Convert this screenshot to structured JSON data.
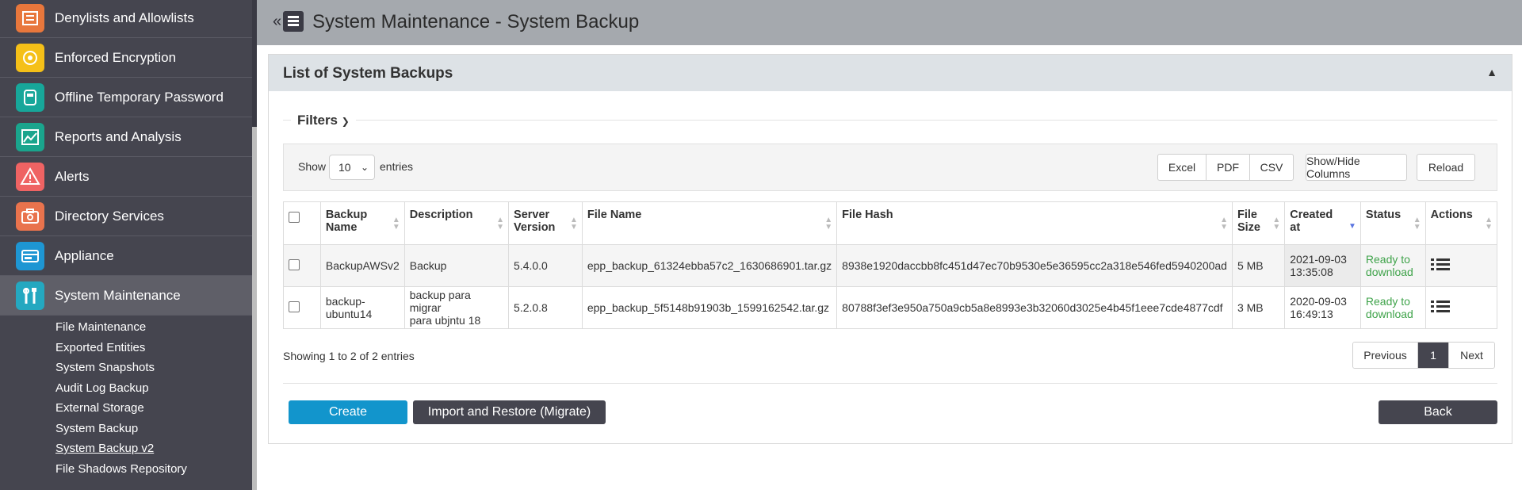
{
  "sidebar": {
    "items": [
      {
        "label": "Denylists and Allowlists",
        "icon": "list-icon",
        "color": "#e8773c"
      },
      {
        "label": "Enforced Encryption",
        "icon": "encryption-icon",
        "color": "#f5c018"
      },
      {
        "label": "Offline Temporary Password",
        "icon": "password-icon",
        "color": "#17a79a"
      },
      {
        "label": "Reports and Analysis",
        "icon": "chart-icon",
        "color": "#1aa58d"
      },
      {
        "label": "Alerts",
        "icon": "alert-icon",
        "color": "#ef6363"
      },
      {
        "label": "Directory Services",
        "icon": "directory-icon",
        "color": "#e9734d"
      },
      {
        "label": "Appliance",
        "icon": "appliance-icon",
        "color": "#1e96d3"
      },
      {
        "label": "System Maintenance",
        "icon": "tools-icon",
        "color": "#24a8c0"
      }
    ],
    "sub_items": [
      "File Maintenance",
      "Exported Entities",
      "System Snapshots",
      "Audit Log Backup",
      "External Storage",
      "System Backup",
      "System Backup v2",
      "File Shadows Repository"
    ]
  },
  "header": {
    "title": "System Maintenance - System Backup"
  },
  "panel": {
    "title": "List of System Backups",
    "filters_label": "Filters"
  },
  "toolbar": {
    "show_label": "Show",
    "page_length": "10",
    "entries_label": "entries",
    "excel": "Excel",
    "pdf": "PDF",
    "csv": "CSV",
    "columns": "Show/Hide Columns",
    "reload": "Reload"
  },
  "table": {
    "headers": {
      "name_1": "Backup",
      "name_2": "Name",
      "description": "Description",
      "version_1": "Server",
      "version_2": "Version",
      "file_name": "File Name",
      "file_hash": "File Hash",
      "size_1": "File",
      "size_2": "Size",
      "created_1": "Created",
      "created_2": "at",
      "status": "Status",
      "actions": "Actions"
    },
    "rows": [
      {
        "name_1": "BackupAWSv2",
        "name_2": "",
        "description_1": "Backup",
        "description_2": "",
        "version": "5.4.0.0",
        "file_name": "epp_backup_61324ebba57c2_1630686901.tar.gz",
        "file_hash": "8938e1920daccbb8fc451d47ec70b9530e5e36595cc2a318e546fed5940200ad",
        "size": "5 MB",
        "created_1": "2021-09-03",
        "created_2": "13:35:08",
        "status_1": "Ready to",
        "status_2": "download"
      },
      {
        "name_1": "backup-",
        "name_2": "ubuntu14",
        "description_1": "backup para migrar",
        "description_2": "para ubjntu 18",
        "version": "5.2.0.8",
        "file_name": "epp_backup_5f5148b91903b_1599162542.tar.gz",
        "file_hash": "80788f3ef3e950a750a9cb5a8e8993e3b32060d3025e4b45f1eee7cde4877cdf",
        "size": "3 MB",
        "created_1": "2020-09-03",
        "created_2": "16:49:13",
        "status_1": "Ready to",
        "status_2": "download"
      }
    ]
  },
  "footer": {
    "info": "Showing 1 to 2 of 2 entries",
    "previous": "Previous",
    "page": "1",
    "next": "Next",
    "create": "Create",
    "import": "Import and Restore (Migrate)",
    "back": "Back"
  },
  "colors": {
    "create": "#1295cc",
    "dark_button": "#45454f",
    "status": "#3fa34a"
  }
}
